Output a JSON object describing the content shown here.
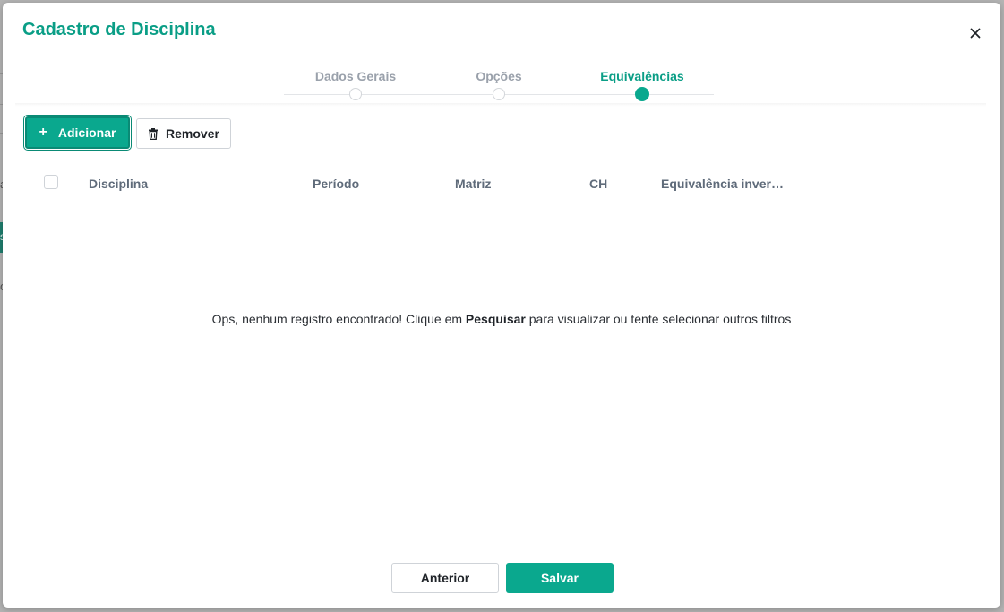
{
  "modal": {
    "title": "Cadastro de Disciplina"
  },
  "stepper": {
    "steps": [
      {
        "label": "Dados Gerais",
        "active": false
      },
      {
        "label": "Opções",
        "active": false
      },
      {
        "label": "Equivalências",
        "active": true
      }
    ]
  },
  "toolbar": {
    "add_label": "Adicionar",
    "add_icon": "plus-icon",
    "remove_label": "Remover",
    "remove_icon": "trash-icon"
  },
  "table": {
    "columns": [
      "Disciplina",
      "Período",
      "Matriz",
      "CH",
      "Equivalência inver…"
    ],
    "rows": []
  },
  "empty_state": {
    "prefix": "Ops, nenhum registro encontrado! Clique em ",
    "emphasis": "Pesquisar",
    "suffix": " para visualizar ou tente selecionar outros filtros"
  },
  "footer": {
    "previous_label": "Anterior",
    "save_label": "Salvar"
  },
  "colors": {
    "accent": "#0aa88e",
    "title": "#0a9e86"
  },
  "background": {
    "fragments": [
      "a",
      "s",
      "o"
    ]
  }
}
